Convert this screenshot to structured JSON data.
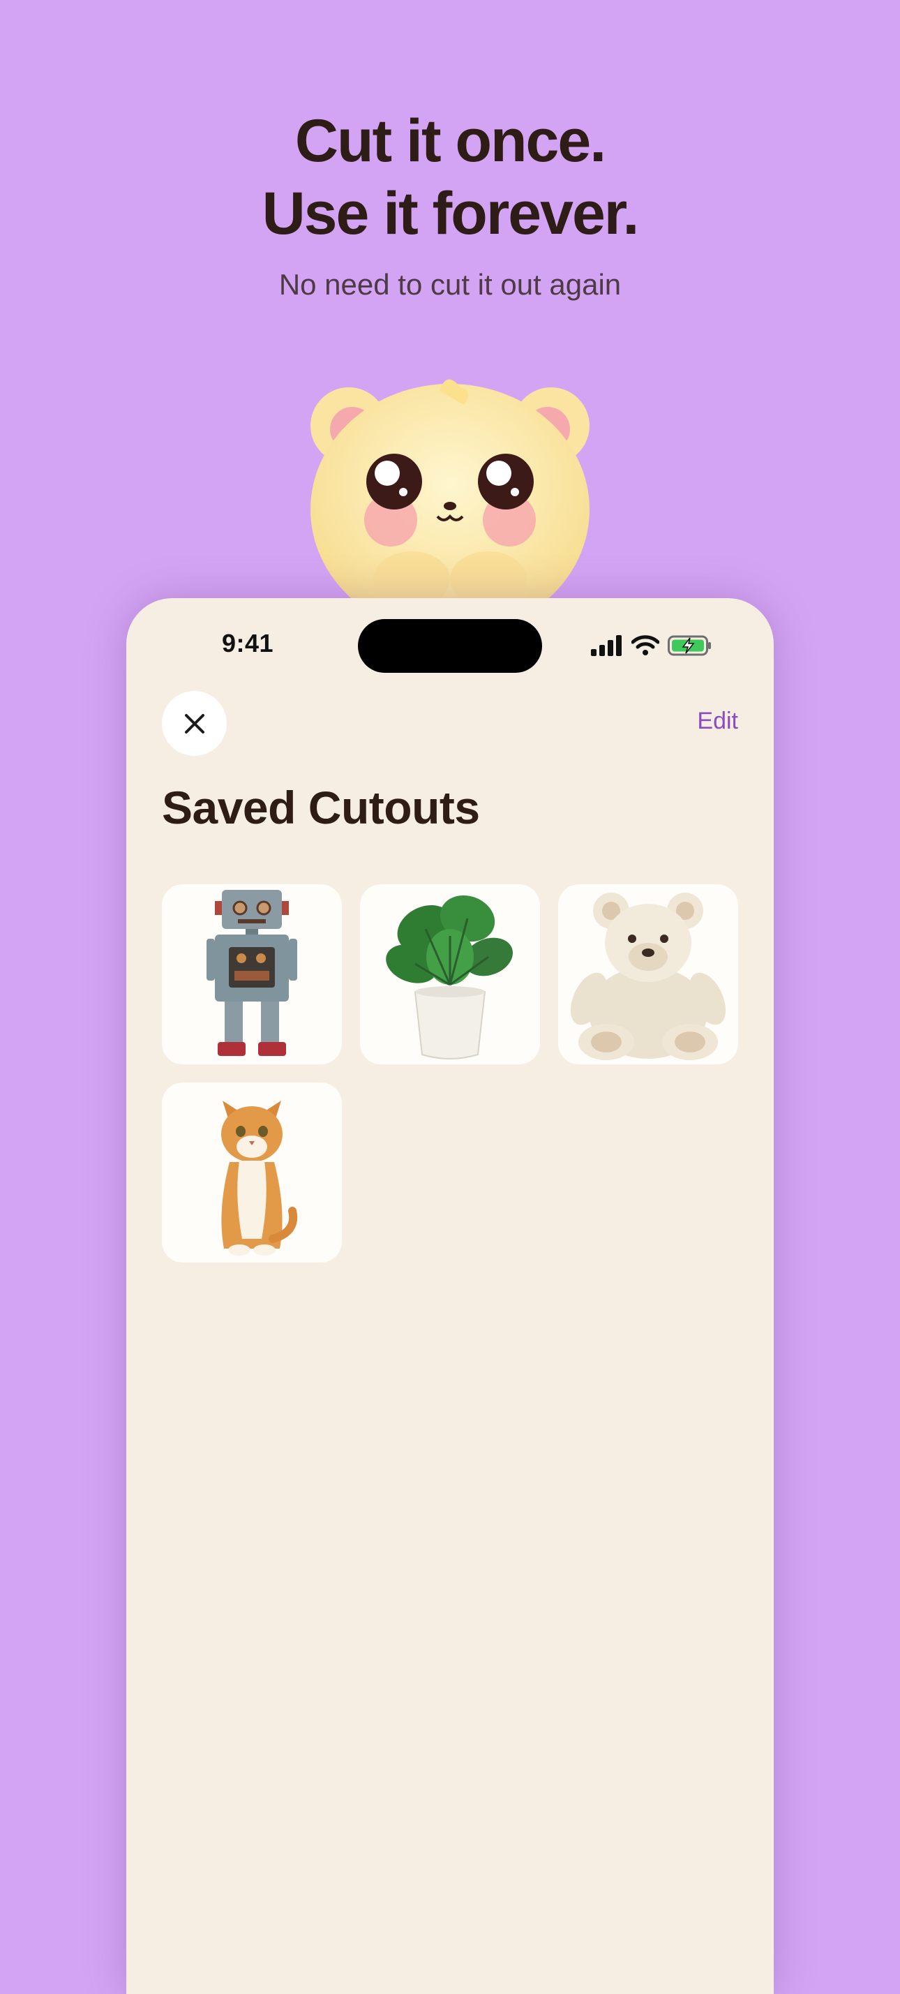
{
  "hero": {
    "title_line1": "Cut it once.",
    "title_line2": "Use it forever.",
    "subtitle": "No need to cut it out again"
  },
  "mascot": {
    "icon": "bear-mascot-icon"
  },
  "status_bar": {
    "time": "9:41",
    "icons": [
      "signal-icon",
      "wifi-icon",
      "battery-charging-icon"
    ]
  },
  "toolbar": {
    "close_icon": "close-icon",
    "edit_label": "Edit"
  },
  "page": {
    "title": "Saved Cutouts"
  },
  "cutouts": [
    {
      "icon": "robot-icon"
    },
    {
      "icon": "plant-icon"
    },
    {
      "icon": "teddy-bear-icon"
    },
    {
      "icon": "cat-icon"
    }
  ],
  "colors": {
    "background": "#d4a4f4",
    "panel": "#f6eee3",
    "title_text": "#2e1d16",
    "accent": "#8b4cc0",
    "tile": "#fffdf9"
  }
}
